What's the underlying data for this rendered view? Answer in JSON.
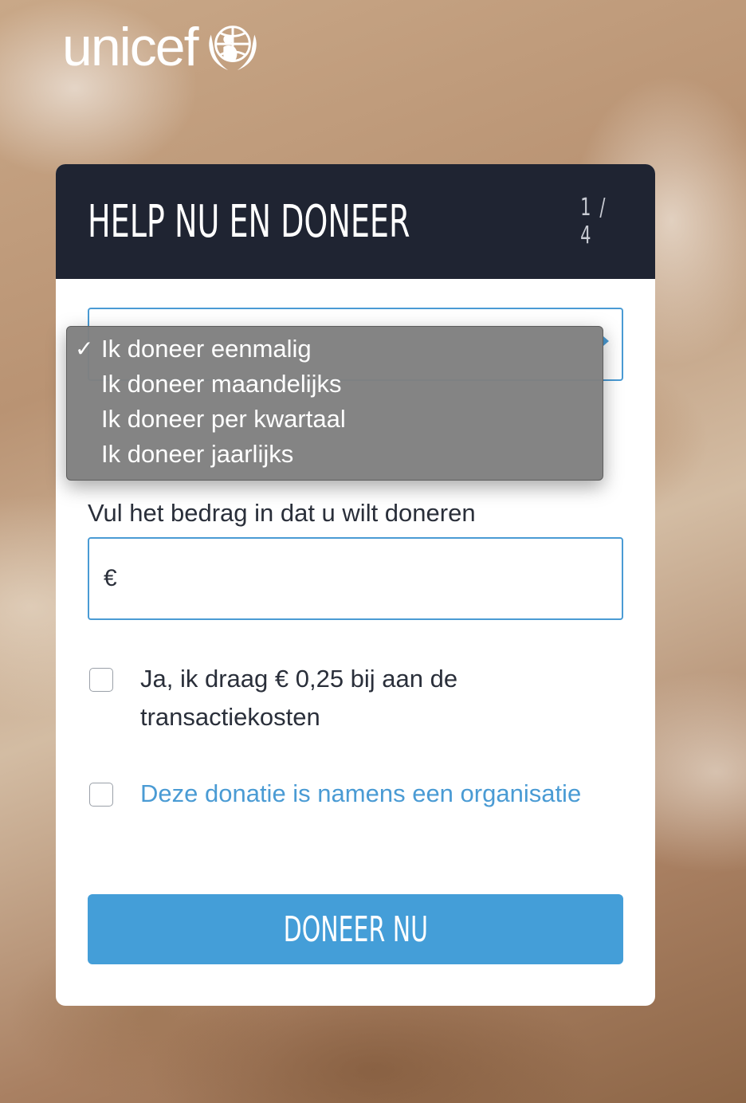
{
  "logo": {
    "text": "unicef"
  },
  "card": {
    "title": "HELP NU EN DONEER",
    "step": "1 / 4"
  },
  "frequency": {
    "options": [
      "Ik doneer eenmalig",
      "Ik doneer maandelijks",
      "Ik doneer per kwartaal",
      "Ik doneer jaarlijks"
    ],
    "selected": "Ik doneer eenmalig",
    "checkmark": "✓"
  },
  "amount": {
    "label": "Vul het bedrag in dat u wilt doneren",
    "currency": "€",
    "value": ""
  },
  "checkboxes": [
    {
      "label": "Ja, ik draag € 0,25 bij aan de transactiekosten",
      "checked": false
    },
    {
      "label": "Deze donatie is namens een organisatie",
      "checked": false
    }
  ],
  "button": {
    "label": "DONEER NU"
  },
  "colors": {
    "accent": "#449ed8",
    "header_bg": "#1f2432",
    "link": "#4a9bd4"
  }
}
